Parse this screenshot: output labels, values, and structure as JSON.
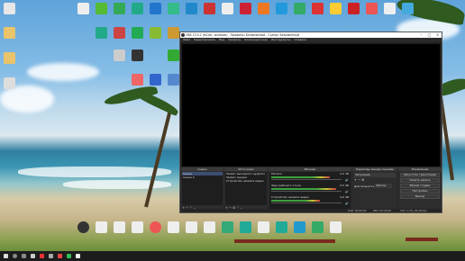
{
  "obs": {
    "title": "OBS 23.0.2 (64-bit, windows) - Профиль: Безымянный - Сцены: Безымянный",
    "menu": [
      "Файл",
      "Редактировать",
      "Вид",
      "Профиль",
      "Коллекция сцен",
      "Инструменты",
      "Справка"
    ],
    "docks": {
      "scenes": {
        "header": "Сцены",
        "items": [
          "Сцена",
          "Сцена 2"
        ]
      },
      "sources": {
        "header": "Источники",
        "items": [
          "Захват выходного аудиопо",
          "Захват экрана",
          "Устройство захвата видео"
        ]
      },
      "mixer": {
        "header": "Микшер",
        "channels": [
          {
            "name": "Mic/Aux",
            "db": "0.0 dB",
            "level": 0.72
          },
          {
            "name": "Звук рабочего стола",
            "db": "-3.5 dB",
            "level": 0.8
          },
          {
            "name": "Устройство захвата видео",
            "db": "0.0 dB",
            "level": 0.6
          }
        ]
      },
      "transitions": {
        "header": "Переходы между сценами",
        "type_label": "Затухание",
        "duration_label": "Длительность",
        "duration_value": "300 ms"
      },
      "controls": {
        "header": "Управление",
        "buttons": [
          "Запустить трансляцию",
          "Начать запись",
          "Режим студии",
          "Настройки",
          "Выход"
        ]
      }
    },
    "statusbar": {
      "live": "LIVE: 00:00:00",
      "rec": "REC: 00:00:00",
      "cpu": "CPU: 1.3%, 60.00 fps"
    }
  },
  "icon_colors": {
    "row1": [
      "#e33",
      "#eee",
      "#5b3",
      "#3a5",
      "#27c",
      "#3b8",
      "#c33",
      "#eee",
      "#e72",
      "#29d",
      "#3a6",
      "#d33",
      "#fc3",
      "#c22",
      "#e55",
      "#eee",
      "#4ad",
      "#1b8"
    ]
  }
}
